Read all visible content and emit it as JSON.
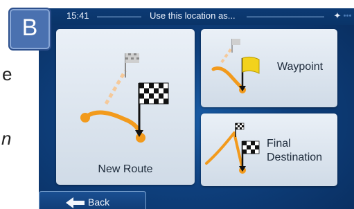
{
  "badge": {
    "letter": "B"
  },
  "slide_fragments": {
    "line1": "e",
    "line2": "n"
  },
  "statusbar": {
    "time": "15:41",
    "title": "Use this location as..."
  },
  "options": {
    "new_route": "New Route",
    "waypoint": "Waypoint",
    "final_destination_line1": "Final",
    "final_destination_line2": "Destination"
  },
  "footer": {
    "back_label": "Back"
  },
  "colors": {
    "route": "#f29a1c",
    "screen_bg": "#0e3f7c",
    "card_bg": "#dfe7f0",
    "flag": "#f3d21c",
    "badge": "#4a71b0"
  }
}
